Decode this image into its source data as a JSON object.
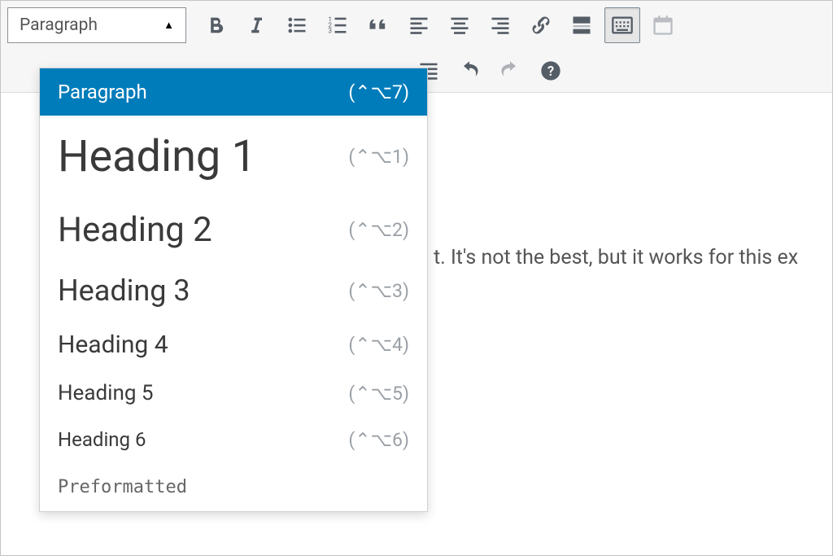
{
  "format_select": {
    "current": "Paragraph"
  },
  "toolbar": {
    "bold": "B",
    "italic": "I"
  },
  "dropdown": {
    "paragraph": {
      "label": "Paragraph",
      "shortcut": "(⌃⌥7)"
    },
    "h1": {
      "label": "Heading 1",
      "shortcut": "(⌃⌥1)"
    },
    "h2": {
      "label": "Heading 2",
      "shortcut": "(⌃⌥2)"
    },
    "h3": {
      "label": "Heading 3",
      "shortcut": "(⌃⌥3)"
    },
    "h4": {
      "label": "Heading 4",
      "shortcut": "(⌃⌥4)"
    },
    "h5": {
      "label": "Heading 5",
      "shortcut": "(⌃⌥5)"
    },
    "h6": {
      "label": "Heading 6",
      "shortcut": "(⌃⌥6)"
    },
    "pre": {
      "label": "Preformatted"
    }
  },
  "content": {
    "fragment": "t. It's not the best, but it works for this ex"
  }
}
